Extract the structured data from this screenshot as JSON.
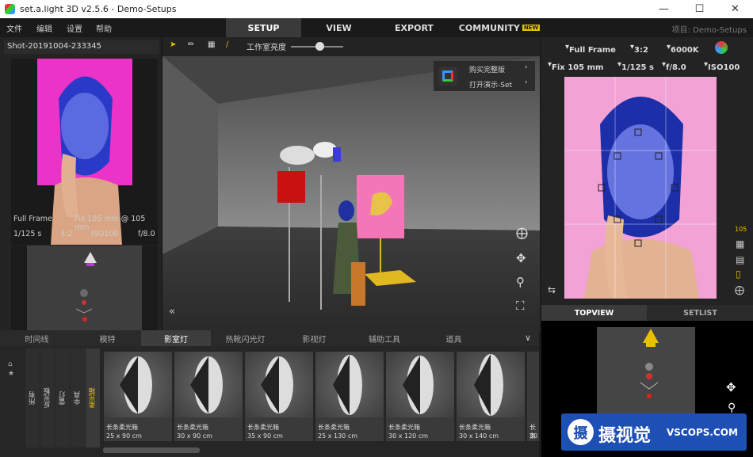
{
  "window": {
    "title": "set.a.light 3D v2.5.6 - Demo-Setups"
  },
  "menu": {
    "file": "文件",
    "edit": "编辑",
    "settings": "设置",
    "help": "帮助"
  },
  "main_tabs": {
    "setup": "SETUP",
    "view": "VIEW",
    "export": "EXPORT",
    "community": "COMMUNITY",
    "new_badge": "NEW"
  },
  "project": "项目: Demo-Setups",
  "left": {
    "shot_name": "Shot-20191004-233345",
    "sensor": "Full Frame",
    "lens": "Fix 105 mm @ 105 mm",
    "shutter": "1/125 s",
    "ratio": "3:2",
    "iso": "ISO100",
    "aperture": "f/8.0"
  },
  "viewport": {
    "brightness_label": "工作室亮度",
    "buy": "购买完整版",
    "open_demo": "打开演示-Set",
    "brightness": 0.55
  },
  "camera": {
    "sensor": "Full Frame",
    "ratio": "3:2",
    "wb": "6000K",
    "lens": "Fix 105 mm",
    "shutter": "1/125 s",
    "aperture": "f/8.0",
    "iso": "ISO100",
    "side_value": "105"
  },
  "right_tabs": {
    "topview": "TOPVIEW",
    "setlist": "SETLIST"
  },
  "categories": [
    "时间线",
    "模特",
    "影室灯",
    "热靴闪光灯",
    "影视灯",
    "辅助工具",
    "道具"
  ],
  "side_categories": [
    "所有",
    "反光板",
    "雷灯",
    "伞具",
    "柔光箱"
  ],
  "cards": [
    {
      "name": "长条柔光箱",
      "size": "25 x 90 cm"
    },
    {
      "name": "长条柔光箱",
      "size": "30 x 90 cm"
    },
    {
      "name": "长条柔光箱",
      "size": "35 x 90 cm"
    },
    {
      "name": "长条柔光箱",
      "size": "25 x 130 cm"
    },
    {
      "name": "长条柔光箱",
      "size": "30 x 120 cm"
    },
    {
      "name": "长条柔光箱",
      "size": "30 x 140 cm"
    },
    {
      "name": "长条柔光箱",
      "size": "30"
    }
  ],
  "watermark": {
    "brand": "摄视觉",
    "site": "VSCOPS.COM",
    "logo_char": "摄"
  }
}
